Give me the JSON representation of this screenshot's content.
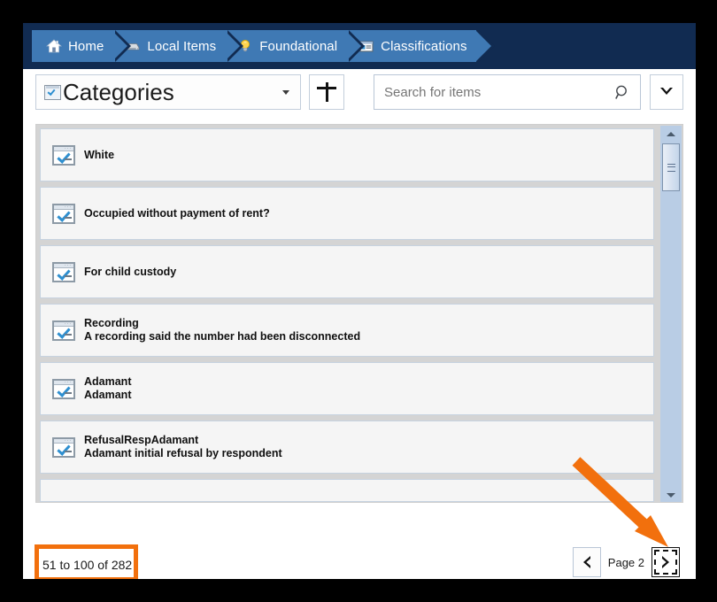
{
  "breadcrumb": {
    "items": [
      {
        "label": "Home",
        "icon": "home-icon"
      },
      {
        "label": "Local Items",
        "icon": "disk-icon"
      },
      {
        "label": "Foundational",
        "icon": "lightbulb-icon"
      },
      {
        "label": "Classifications",
        "icon": "form-window-icon"
      }
    ]
  },
  "toolbar": {
    "category_label": "Categories",
    "category_icon": "checked-window-icon",
    "add_label": "+",
    "add_icon": "plus-icon",
    "search_placeholder": "Search for items",
    "search_value": "",
    "search_icon": "magnifier-icon",
    "filter_icon": "chevron-down-icon"
  },
  "list": {
    "items": [
      {
        "title": "White",
        "subtitle": "",
        "icon": "checked-window-icon"
      },
      {
        "title": "Occupied without payment of rent?",
        "subtitle": "",
        "icon": "checked-window-icon"
      },
      {
        "title": "For child custody",
        "subtitle": "",
        "icon": "checked-window-icon"
      },
      {
        "title": "Recording",
        "subtitle": "A recording said the number had been disconnected",
        "icon": "checked-window-icon"
      },
      {
        "title": "Adamant",
        "subtitle": "Adamant",
        "icon": "checked-window-icon"
      },
      {
        "title": "RefusalRespAdamant",
        "subtitle": "Adamant initial refusal by respondent",
        "icon": "checked-window-icon"
      },
      {
        "title": "",
        "subtitle": "",
        "icon": "checked-window-icon"
      }
    ]
  },
  "scrollbar": {
    "up_icon": "triangle-up-icon",
    "down_icon": "triangle-down-icon",
    "thumb_position_percent": 5
  },
  "footer": {
    "range_text": "51 to 100 of 282",
    "page_label": "Page 2",
    "prev_icon": "chevron-left-icon",
    "next_icon": "chevron-right-icon",
    "highlight_color": "#f2700d"
  },
  "annotation": {
    "arrow_color": "#f2700d",
    "points_to": "next-page-button"
  },
  "theme": {
    "header_navy": "#112b51",
    "crumb_blue": "#3f79b4",
    "panel_gray": "#d4d4d4",
    "item_border": "#c6d2e0",
    "scroll_track": "#b9cde5"
  }
}
